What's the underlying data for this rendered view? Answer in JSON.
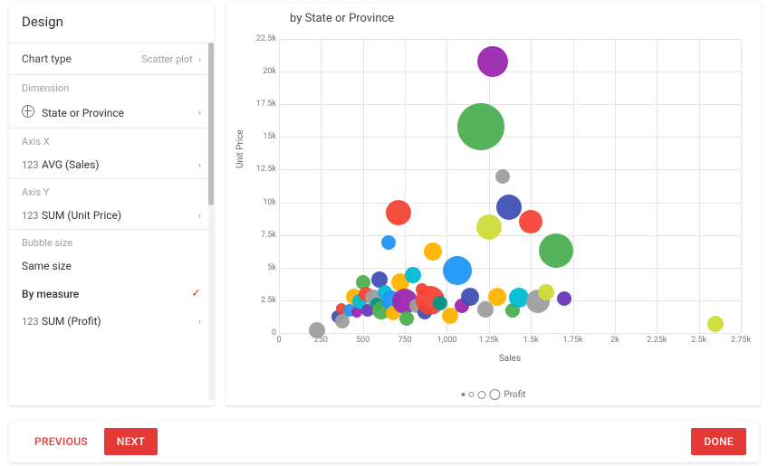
{
  "panel": {
    "title": "Design",
    "chartType": {
      "label": "Chart type",
      "value": "Scatter plot"
    },
    "dimension": {
      "label": "Dimension",
      "value": "State or Province",
      "iconPrefix": ""
    },
    "axisX": {
      "label": "Axis X",
      "prefix": "123",
      "value": "AVG (Sales)"
    },
    "axisY": {
      "label": "Axis Y",
      "prefix": "123",
      "value": "SUM (Unit Price)"
    },
    "bubbleSize": {
      "label": "Bubble size",
      "sameSize": "Same size",
      "byMeasure": "By measure",
      "measurePrefix": "123",
      "measure": "SUM (Profit)"
    }
  },
  "footer": {
    "previous": "PREVIOUS",
    "next": "NEXT",
    "done": "DONE"
  },
  "chart_data": {
    "type": "scatter",
    "title": "by State or Province",
    "xlabel": "Sales",
    "ylabel": "Unit Price",
    "size_label": "Profit",
    "xlim": [
      0,
      2750
    ],
    "ylim": [
      0,
      22500
    ],
    "xticks": [
      0,
      250,
      500,
      750,
      1000,
      1250,
      1500,
      1750,
      2000,
      2250,
      2500,
      2750
    ],
    "xtick_labels": [
      "0",
      "250",
      "500",
      "750",
      "1,000",
      "1.25k",
      "1.5k",
      "1.75k",
      "2k",
      "2.25k",
      "2.5k",
      "2.75k"
    ],
    "yticks": [
      0,
      2500,
      5000,
      7500,
      10000,
      12500,
      15000,
      17500,
      20000,
      22500
    ],
    "ytick_labels": [
      "0",
      "2.5k",
      "5k",
      "7.5k",
      "10k",
      "12.5k",
      "15k",
      "17.5k",
      "20k",
      "22.5k"
    ],
    "points": [
      {
        "x": 225,
        "y": 200,
        "r": 9,
        "color": "#9e9e9e"
      },
      {
        "x": 350,
        "y": 1250,
        "r": 7,
        "color": "#3f51b5"
      },
      {
        "x": 370,
        "y": 1900,
        "r": 6,
        "color": "#f44336"
      },
      {
        "x": 380,
        "y": 900,
        "r": 8,
        "color": "#9e9e9e"
      },
      {
        "x": 420,
        "y": 1750,
        "r": 7,
        "color": "#2196f3"
      },
      {
        "x": 450,
        "y": 2800,
        "r": 9,
        "color": "#ffb300"
      },
      {
        "x": 465,
        "y": 1600,
        "r": 6,
        "color": "#9c27b0"
      },
      {
        "x": 480,
        "y": 2400,
        "r": 8,
        "color": "#00bcd4"
      },
      {
        "x": 500,
        "y": 3900,
        "r": 8,
        "color": "#4caf50"
      },
      {
        "x": 520,
        "y": 3000,
        "r": 8,
        "color": "#f44336"
      },
      {
        "x": 530,
        "y": 1700,
        "r": 7,
        "color": "#673ab7"
      },
      {
        "x": 560,
        "y": 2700,
        "r": 9,
        "color": "#9e9e9e"
      },
      {
        "x": 580,
        "y": 2200,
        "r": 7,
        "color": "#009688"
      },
      {
        "x": 600,
        "y": 4100,
        "r": 9,
        "color": "#3f51b5"
      },
      {
        "x": 610,
        "y": 1700,
        "r": 10,
        "color": "#4caf50"
      },
      {
        "x": 630,
        "y": 3100,
        "r": 8,
        "color": "#00bcd4"
      },
      {
        "x": 650,
        "y": 6900,
        "r": 8,
        "color": "#2196f3"
      },
      {
        "x": 670,
        "y": 2500,
        "r": 11,
        "color": "#2196f3"
      },
      {
        "x": 680,
        "y": 1500,
        "r": 8,
        "color": "#ffb300"
      },
      {
        "x": 710,
        "y": 9200,
        "r": 14,
        "color": "#f44336"
      },
      {
        "x": 720,
        "y": 3900,
        "r": 10,
        "color": "#ffb300"
      },
      {
        "x": 750,
        "y": 2400,
        "r": 14,
        "color": "#9c27b0"
      },
      {
        "x": 760,
        "y": 1100,
        "r": 8,
        "color": "#4caf50"
      },
      {
        "x": 800,
        "y": 4400,
        "r": 9,
        "color": "#00bcd4"
      },
      {
        "x": 820,
        "y": 2100,
        "r": 8,
        "color": "#9e9e9e"
      },
      {
        "x": 850,
        "y": 3300,
        "r": 7,
        "color": "#f44336"
      },
      {
        "x": 870,
        "y": 1600,
        "r": 8,
        "color": "#3f51b5"
      },
      {
        "x": 900,
        "y": 2500,
        "r": 16,
        "color": "#f44336"
      },
      {
        "x": 915,
        "y": 6200,
        "r": 10,
        "color": "#ffb300"
      },
      {
        "x": 960,
        "y": 2300,
        "r": 8,
        "color": "#009688"
      },
      {
        "x": 1020,
        "y": 1300,
        "r": 9,
        "color": "#ffb300"
      },
      {
        "x": 1060,
        "y": 4800,
        "r": 16,
        "color": "#2196f3"
      },
      {
        "x": 1090,
        "y": 2100,
        "r": 8,
        "color": "#9c27b0"
      },
      {
        "x": 1140,
        "y": 2800,
        "r": 10,
        "color": "#3f51b5"
      },
      {
        "x": 1200,
        "y": 15800,
        "r": 26,
        "color": "#4caf50"
      },
      {
        "x": 1230,
        "y": 1800,
        "r": 9,
        "color": "#9e9e9e"
      },
      {
        "x": 1250,
        "y": 8100,
        "r": 14,
        "color": "#cddc39"
      },
      {
        "x": 1270,
        "y": 20800,
        "r": 17,
        "color": "#9c27b0"
      },
      {
        "x": 1300,
        "y": 2800,
        "r": 10,
        "color": "#ffb300"
      },
      {
        "x": 1330,
        "y": 12000,
        "r": 8,
        "color": "#9e9e9e"
      },
      {
        "x": 1370,
        "y": 9600,
        "r": 14,
        "color": "#3f51b5"
      },
      {
        "x": 1390,
        "y": 1700,
        "r": 8,
        "color": "#4caf50"
      },
      {
        "x": 1430,
        "y": 2700,
        "r": 11,
        "color": "#00bcd4"
      },
      {
        "x": 1500,
        "y": 8500,
        "r": 13,
        "color": "#f44336"
      },
      {
        "x": 1540,
        "y": 2400,
        "r": 13,
        "color": "#9e9e9e"
      },
      {
        "x": 1590,
        "y": 3100,
        "r": 9,
        "color": "#cddc39"
      },
      {
        "x": 1650,
        "y": 6300,
        "r": 19,
        "color": "#4caf50"
      },
      {
        "x": 1700,
        "y": 2600,
        "r": 8,
        "color": "#673ab7"
      },
      {
        "x": 2600,
        "y": 700,
        "r": 9,
        "color": "#cddc39"
      }
    ]
  }
}
